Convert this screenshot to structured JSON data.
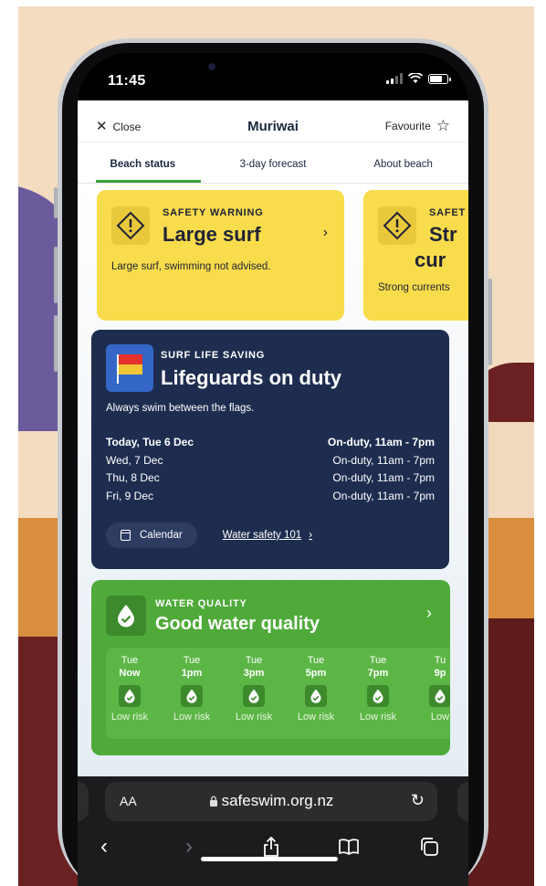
{
  "status_bar": {
    "time": "11:45"
  },
  "nav": {
    "close_label": "Close",
    "title": "Muriwai",
    "favourite_label": "Favourite"
  },
  "tabs": [
    {
      "label": "Beach status",
      "active": true
    },
    {
      "label": "3-day forecast",
      "active": false
    },
    {
      "label": "About beach",
      "active": false
    }
  ],
  "warnings": [
    {
      "kicker": "SAFETY WARNING",
      "headline": "Large surf",
      "description": "Large surf, swimming not advised."
    },
    {
      "kicker": "SAFET",
      "headline_line1": "Str",
      "headline_line2": "cur",
      "description": "Strong currents"
    }
  ],
  "lifeguards": {
    "kicker": "SURF LIFE SAVING",
    "headline": "Lifeguards on duty",
    "subtitle": "Always swim between the flags.",
    "schedule": [
      {
        "day": "Today, Tue 6 Dec",
        "status": "On-duty, 11am - 7pm"
      },
      {
        "day": "Wed, 7 Dec",
        "status": "On-duty, 11am - 7pm"
      },
      {
        "day": "Thu, 8 Dec",
        "status": "On-duty, 11am - 7pm"
      },
      {
        "day": "Fri, 9 Dec",
        "status": "On-duty, 11am - 7pm"
      }
    ],
    "calendar_label": "Calendar",
    "calendar_icon_text": "31",
    "water_safety_link": "Water safety 101"
  },
  "water_quality": {
    "kicker": "WATER QUALITY",
    "headline": "Good water quality",
    "forecast": [
      {
        "day": "Tue",
        "time": "Now",
        "risk": "Low risk"
      },
      {
        "day": "Tue",
        "time": "1pm",
        "risk": "Low risk"
      },
      {
        "day": "Tue",
        "time": "3pm",
        "risk": "Low risk"
      },
      {
        "day": "Tue",
        "time": "5pm",
        "risk": "Low risk"
      },
      {
        "day": "Tue",
        "time": "7pm",
        "risk": "Low risk"
      },
      {
        "day": "Tu",
        "time": "9p",
        "risk": "Low"
      }
    ]
  },
  "browser": {
    "text_size_label": "AA",
    "url": "safeswim.org.nz"
  },
  "colors": {
    "warning_yellow": "#f8dc4c",
    "lifeguard_navy": "#1e2d4f",
    "water_green": "#4faa3a",
    "tab_underline": "#3ca341",
    "flag_red": "#e5322d",
    "flag_yellow": "#f2c634"
  },
  "icons": [
    "close-icon",
    "star-icon",
    "warning-diamond-icon",
    "chevron-right-icon",
    "flag-icon",
    "calendar-icon",
    "water-drop-icon",
    "lock-icon",
    "reload-icon",
    "back-icon",
    "forward-icon",
    "share-icon",
    "bookmarks-icon",
    "tabs-icon"
  ]
}
